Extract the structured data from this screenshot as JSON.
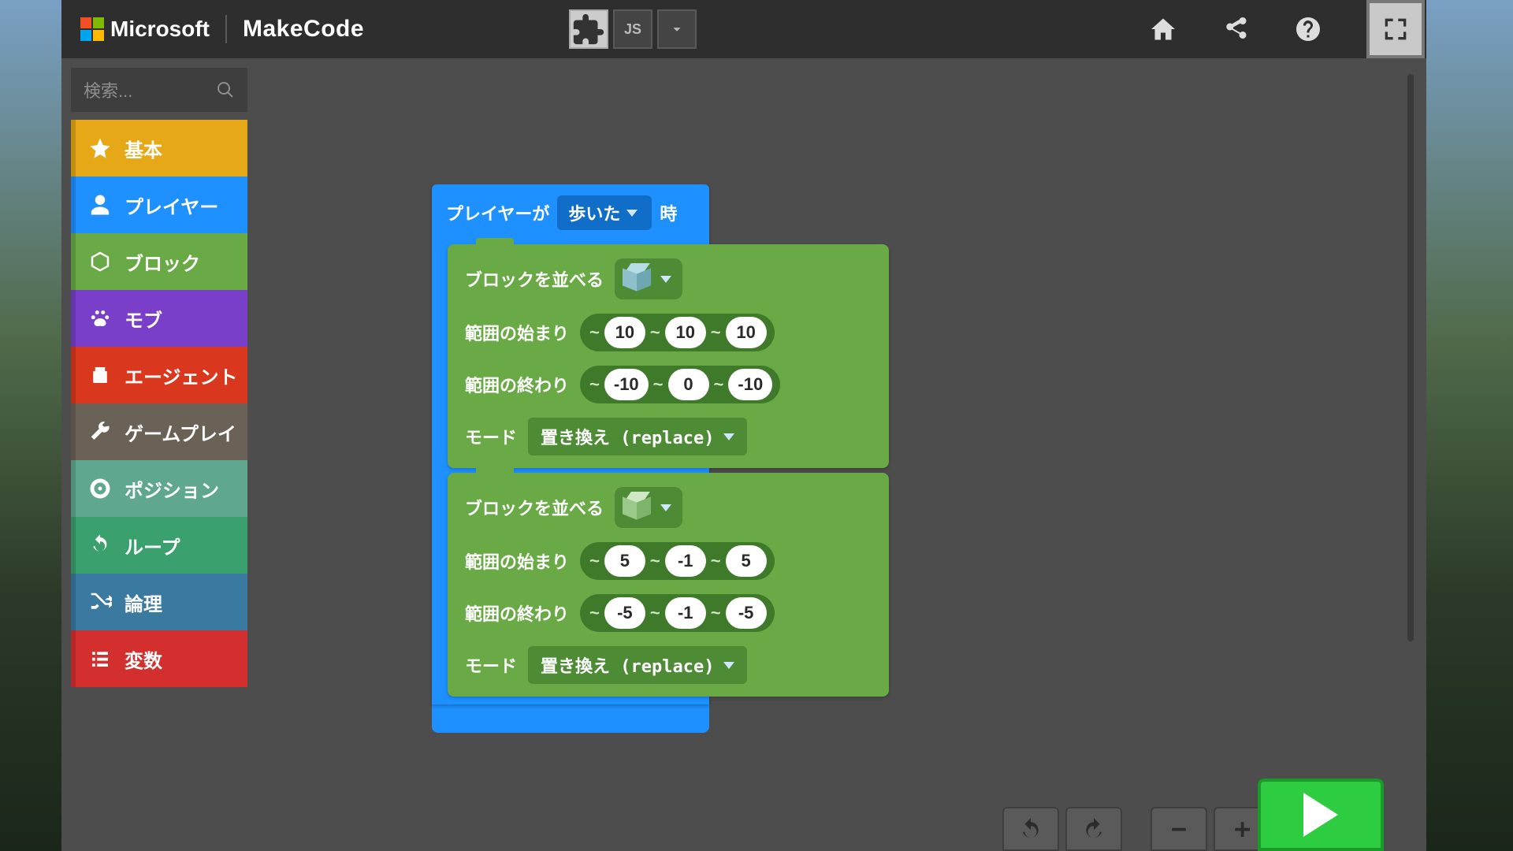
{
  "header": {
    "brand": "Microsoft",
    "product": "MakeCode",
    "js_tab": "JS"
  },
  "search": {
    "placeholder": "検索..."
  },
  "categories": [
    {
      "label": "基本",
      "color": "#e6a817",
      "icon": "star"
    },
    {
      "label": "プレイヤー",
      "color": "#1e90ff",
      "icon": "user"
    },
    {
      "label": "ブロック",
      "color": "#6aaa46",
      "icon": "cube"
    },
    {
      "label": "モブ",
      "color": "#7a3fc9",
      "icon": "paw"
    },
    {
      "label": "エージェント",
      "color": "#d9381e",
      "icon": "robot"
    },
    {
      "label": "ゲームプレイ",
      "color": "#6b6257",
      "icon": "wrench"
    },
    {
      "label": "ポジション",
      "color": "#5fa88f",
      "icon": "target"
    },
    {
      "label": "ループ",
      "color": "#3aa06e",
      "icon": "loop"
    },
    {
      "label": "論理",
      "color": "#3a7aa0",
      "icon": "shuffle"
    },
    {
      "label": "変数",
      "color": "#d32f2f",
      "icon": "list"
    }
  ],
  "event": {
    "prefix": "プレイヤーが",
    "action": "歩いた",
    "suffix": "時"
  },
  "fill1": {
    "title": "ブロックを並べる",
    "start_label": "範囲の始まり",
    "end_label": "範囲の終わり",
    "mode_label": "モード",
    "mode_value": "置き換え (replace)",
    "start": {
      "x": "10",
      "y": "10",
      "z": "10"
    },
    "end": {
      "x": "-10",
      "y": "0",
      "z": "-10"
    },
    "block_kind": "glass"
  },
  "fill2": {
    "title": "ブロックを並べる",
    "start_label": "範囲の始まり",
    "end_label": "範囲の終わり",
    "mode_label": "モード",
    "mode_value": "置き換え (replace)",
    "start": {
      "x": "5",
      "y": "-1",
      "z": "5"
    },
    "end": {
      "x": "-5",
      "y": "-1",
      "z": "-5"
    },
    "block_kind": "solid"
  },
  "tilde": "~"
}
